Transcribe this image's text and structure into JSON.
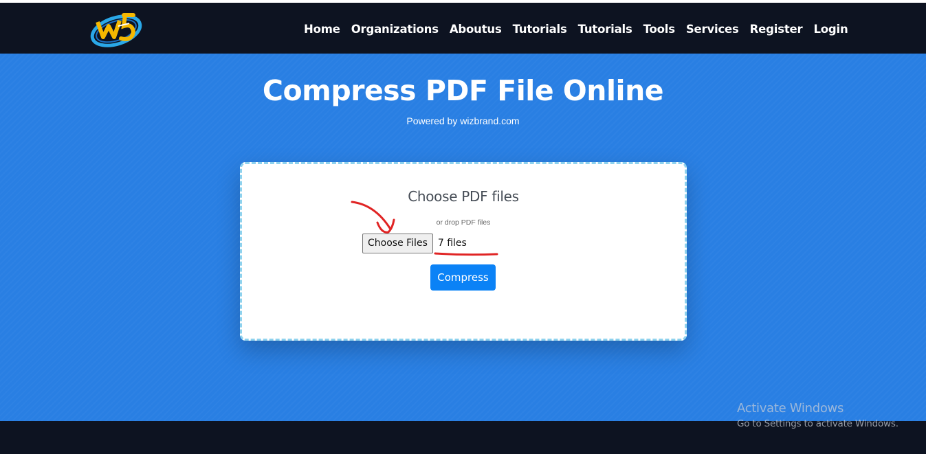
{
  "nav": {
    "links": [
      "Home",
      "Organizations",
      "Aboutus",
      "Tutorials",
      "Tutorials",
      "Tools",
      "Services",
      "Register",
      "Login"
    ],
    "logo_icon": "wizbrand-logo-icon"
  },
  "hero": {
    "title": "Compress PDF File Online",
    "subtitle": "Powered by wizbrand.com"
  },
  "upload": {
    "heading": "Choose PDF files",
    "hint": "or drop PDF files",
    "choose_label": "Choose Files",
    "file_count": "7 files",
    "submit_label": "Compress"
  },
  "annotation": {
    "arrow_icon": "red-arrow-icon",
    "color": "#e02424"
  },
  "watermark": {
    "title": "Activate Windows",
    "subtitle": "Go to Settings to activate Windows."
  },
  "colors": {
    "navbar_bg": "#0d1321",
    "hero_bg": "#297fe3",
    "button_blue": "#0b82f6",
    "card_border": "#8ed2ee"
  }
}
